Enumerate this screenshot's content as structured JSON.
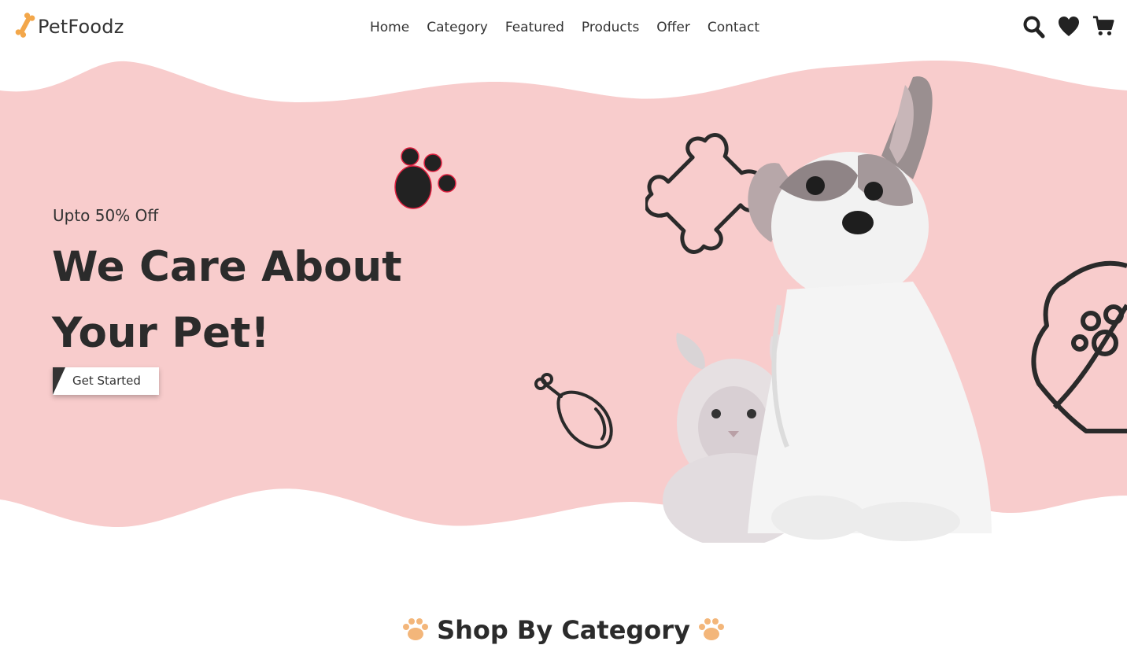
{
  "brand": {
    "name": "PetFoodz",
    "accent": "#f3a74a"
  },
  "nav": {
    "items": [
      "Home",
      "Category",
      "Featured",
      "Products",
      "Offer",
      "Contact"
    ]
  },
  "header_icons": [
    "search-icon",
    "heart-icon",
    "cart-icon"
  ],
  "hero": {
    "offer": "Upto 50% Off",
    "title_line1": "We Care About",
    "title_line2": "Your Pet!",
    "cta": "Get Started",
    "bg_color": "#f8cccc"
  },
  "section": {
    "title": "Shop By Category"
  }
}
